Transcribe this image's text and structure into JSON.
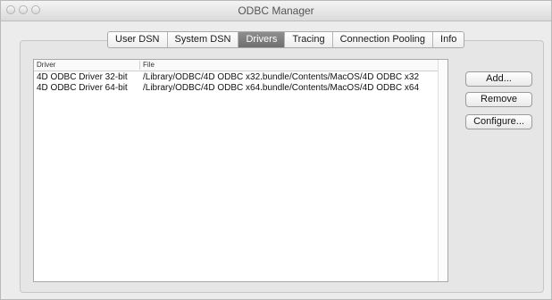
{
  "window": {
    "title": "ODBC Manager"
  },
  "tabs": [
    {
      "label": "User DSN",
      "active": false
    },
    {
      "label": "System DSN",
      "active": false
    },
    {
      "label": "Drivers",
      "active": true
    },
    {
      "label": "Tracing",
      "active": false
    },
    {
      "label": "Connection Pooling",
      "active": false
    },
    {
      "label": "Info",
      "active": false
    }
  ],
  "table": {
    "columns": [
      "Driver",
      "File"
    ],
    "rows": [
      {
        "driver": "4D ODBC Driver 32-bit",
        "file": "/Library/ODBC/4D ODBC x32.bundle/Contents/MacOS/4D ODBC x32"
      },
      {
        "driver": "4D ODBC Driver 64-bit",
        "file": "/Library/ODBC/4D ODBC x64.bundle/Contents/MacOS/4D ODBC x64"
      }
    ]
  },
  "buttons": {
    "add": "Add...",
    "remove": "Remove",
    "configure": "Configure..."
  }
}
